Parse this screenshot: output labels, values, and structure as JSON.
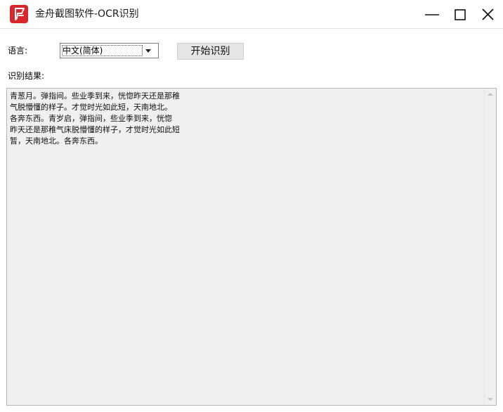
{
  "window": {
    "title": "金舟截图软件-OCR识别",
    "app_icon": "app-logo-icon",
    "controls": {
      "minimize_icon": "minimize-icon",
      "maximize_icon": "maximize-icon",
      "close_icon": "close-icon"
    }
  },
  "toolbar": {
    "language_label": "语言:",
    "language_selected": "中文(简体)",
    "start_button_label": "开始识别"
  },
  "result": {
    "label": "识别结果:",
    "text": "青葱月。弹指间。些业季到来，恍惚昨天还是那稚\n气脱懵懂的样子。才觉时光如此短，天南地北。\n各奔东西。青岁启，弹指间，些业季到来，恍惚\n昨天还是那稚气床脱懵懂的样子，才觉时光如此短\n暂，天南地北。各奔东西。"
  },
  "colors": {
    "app_icon_bg": "#d8262c",
    "result_bg": "#f0f0f0",
    "button_bg": "#e5e5e5"
  }
}
